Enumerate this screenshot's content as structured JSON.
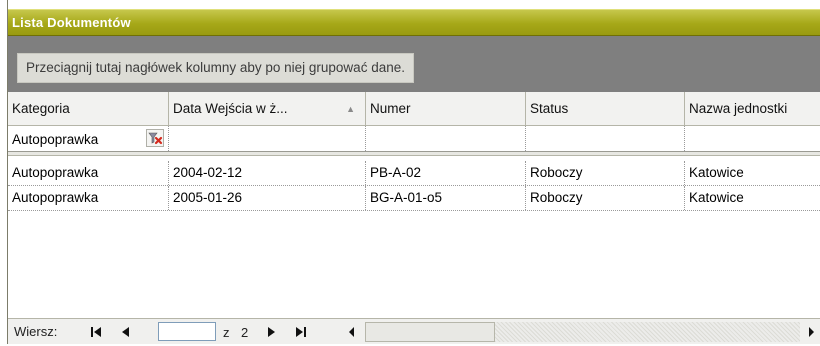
{
  "window": {
    "title": "Lista Dokumentów"
  },
  "group_panel": {
    "hint": "Przeciągnij tutaj nagłówek kolumny aby po niej grupować dane."
  },
  "columns": [
    {
      "label": "Kategoria"
    },
    {
      "label": "Data Wejścia w ż...",
      "sorted": "ascending"
    },
    {
      "label": "Numer"
    },
    {
      "label": "Status"
    },
    {
      "label": "Nazwa jednostki"
    }
  ],
  "filter": {
    "kategoria_value": "Autopoprawka",
    "clear_icon": "clear-filter-icon"
  },
  "rows": [
    {
      "kategoria": "Autopoprawka",
      "data": "2004-02-12",
      "numer": "PB-A-02",
      "status": "Roboczy",
      "jednostka": "Katowice"
    },
    {
      "kategoria": "Autopoprawka",
      "data": "2005-01-26",
      "numer": "BG-A-01-o5",
      "status": "Roboczy",
      "jednostka": "Katowice"
    }
  ],
  "pager": {
    "label": "Wiersz:",
    "of_label": "z",
    "total": "2",
    "current": ""
  },
  "colors": {
    "title_bar": "#a6a818",
    "group_panel": "#7f7f7f"
  }
}
